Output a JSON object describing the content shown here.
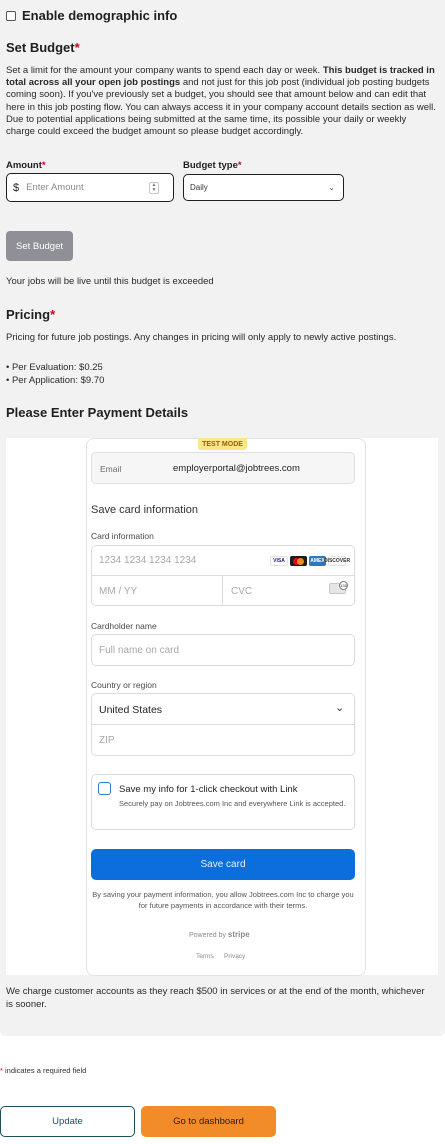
{
  "demographic": {
    "label": "Enable demographic info",
    "checked": false
  },
  "budget": {
    "heading": "Set Budget",
    "required_mark": "*",
    "desc_part1": "Set a limit for the amount your company wants to spend each day or week. ",
    "desc_bold": "This budget is tracked in total across all your open job postings",
    "desc_part2": " and not just for this job post (individual job posting budgets coming soon). If you've previously set a budget, you should see that amount below and can edit that here in this job posting flow. You can always access it in your company account details section as well. Due to potential applications being submitted at the same time, its possible your daily or weekly charge could exceed the budget amount so please budget accordingly.",
    "amount_label": "Amount",
    "amount_currency": "$",
    "amount_placeholder": "Enter Amount",
    "type_label": "Budget type",
    "type_value": "Daily",
    "set_button": "Set Budget",
    "live_note": "Your jobs will be live until this budget is exceeded"
  },
  "pricing": {
    "heading": "Pricing",
    "required_mark": "*",
    "desc": "Pricing for future job postings. Any changes in pricing will only apply to newly active postings.",
    "items": [
      "• Per Evaluation: $0.25",
      "• Per Application: $9.70"
    ]
  },
  "payment": {
    "heading": "Please Enter Payment Details",
    "test_mode": "TEST MODE",
    "email_label": "Email",
    "email_value": "employerportal@jobtrees.com",
    "save_card_info": "Save card information",
    "card_info_label": "Card information",
    "card_number_placeholder": "1234 1234 1234 1234",
    "expiry_placeholder": "MM / YY",
    "cvc_placeholder": "CVC",
    "brands": {
      "visa": "VISA",
      "amex": "AMEX",
      "discover": "DISCOVER"
    },
    "cvc_icon_text": "135",
    "cardholder_label": "Cardholder name",
    "cardholder_placeholder": "Full name on card",
    "country_label": "Country or region",
    "country_value": "United States",
    "zip_placeholder": "ZIP",
    "link_title": "Save my info for 1-click checkout with Link",
    "link_sub": "Securely pay on Jobtrees.com Inc and everywhere Link is accepted.",
    "save_button": "Save card",
    "consent": "By saving your payment information, you allow Jobtrees.com Inc to charge you for future payments in accordance with their terms.",
    "powered_by": "Powered by",
    "stripe": "stripe",
    "terms": "Terms",
    "privacy": "Privacy",
    "charge_note": "We charge customer accounts as they reach $500 in services or at the end of the month, whichever is sooner."
  },
  "footer": {
    "required_mark": "*",
    "required_note": " indicates a required field",
    "update_button": "Update",
    "dashboard_button": "Go to dashboard"
  },
  "colors": {
    "required": "#d0021b",
    "save_card_button": "#0a6fdc",
    "dashboard_button": "#f28c28",
    "update_border": "#1b4f5c",
    "test_mode_bg": "#fde68a"
  }
}
